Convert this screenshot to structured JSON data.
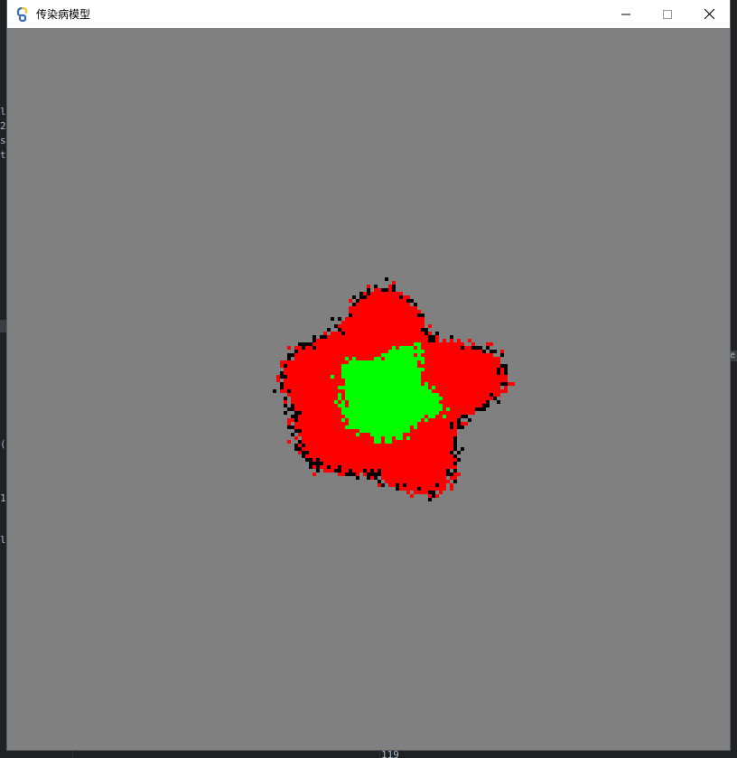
{
  "window": {
    "title": "传染病模型",
    "icon": "pygame-snake-icon",
    "controls": {
      "minimize": "minimize-icon",
      "maximize": "maximize-icon",
      "close": "close-icon"
    }
  },
  "simulation": {
    "background_color": "#808080",
    "states": {
      "infected": {
        "color": "#ff0000"
      },
      "recovered": {
        "color": "#00ff00"
      },
      "dead": {
        "color": "#000000"
      },
      "susceptible": {
        "color": "#808080"
      }
    }
  },
  "background_app": {
    "left_glyphs": [
      "l",
      "2",
      "s",
      "t",
      "(",
      "1",
      "l"
    ],
    "right_glyph": "e",
    "bottom_text": "119"
  }
}
